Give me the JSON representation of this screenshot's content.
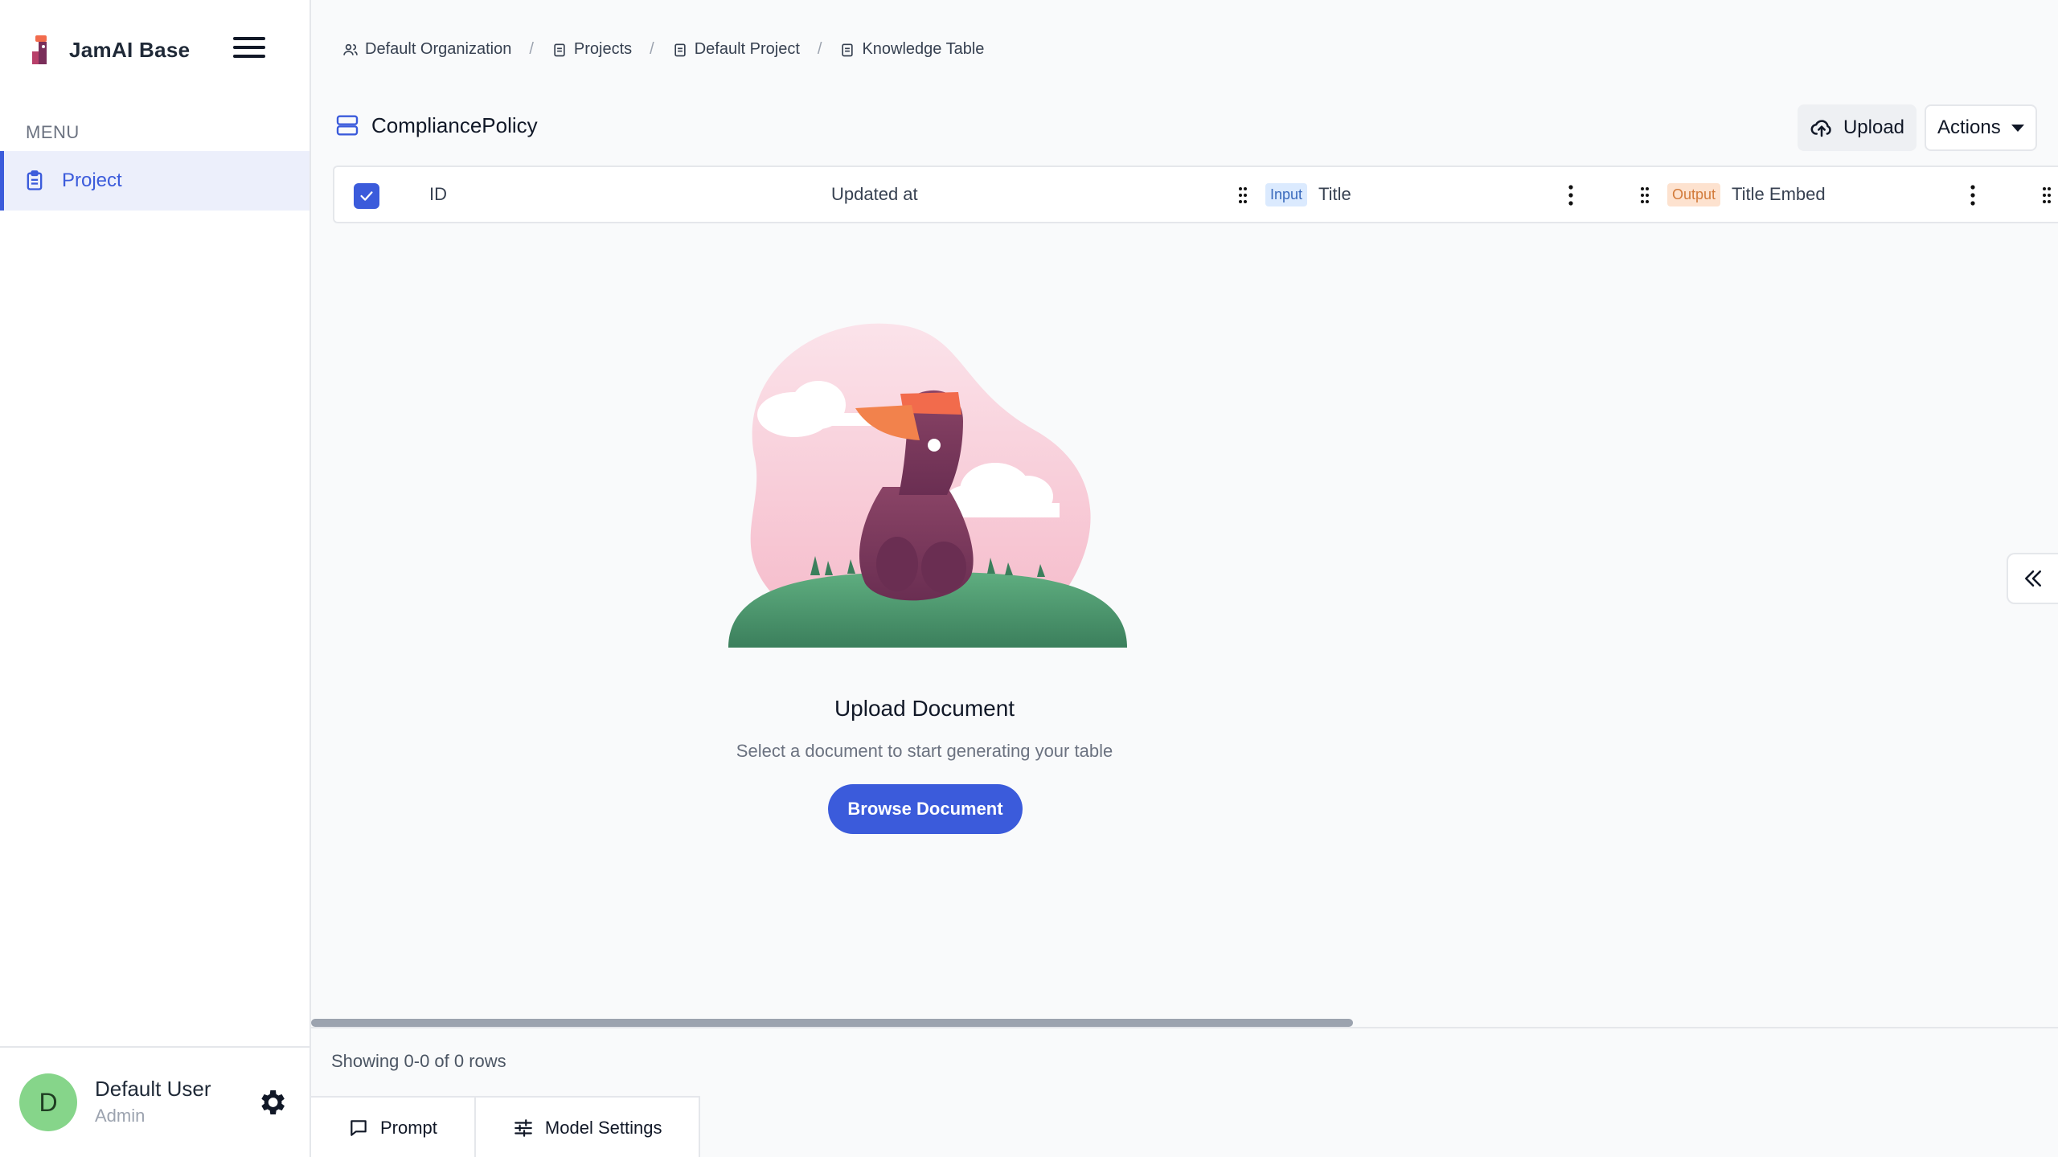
{
  "app": {
    "name": "JamAI Base"
  },
  "sidebar": {
    "menu_label": "MENU",
    "items": [
      {
        "label": "Project",
        "icon": "clipboard-icon",
        "active": true
      }
    ]
  },
  "user": {
    "initial": "D",
    "name": "Default User",
    "role": "Admin"
  },
  "breadcrumb": [
    {
      "label": "Default Organization",
      "icon": "users-icon"
    },
    {
      "label": "Projects",
      "icon": "clipboard-icon"
    },
    {
      "label": "Default Project",
      "icon": "clipboard-icon"
    },
    {
      "label": "Knowledge Table",
      "icon": "clipboard-icon"
    }
  ],
  "breadcrumb_sep": "/",
  "table": {
    "name": "CompliancePolicy",
    "upload_label": "Upload",
    "actions_label": "Actions",
    "columns": [
      {
        "label": "ID"
      },
      {
        "label": "Updated at"
      },
      {
        "label": "Title",
        "tag": "Input"
      },
      {
        "label": "Title Embed",
        "tag": "Output"
      }
    ]
  },
  "empty_state": {
    "title": "Upload Document",
    "subtitle": "Select a document to start generating your table",
    "button": "Browse Document"
  },
  "footer": {
    "row_count": "Showing 0-0 of 0 rows",
    "tabs": [
      {
        "label": "Prompt",
        "icon": "chat-icon"
      },
      {
        "label": "Model Settings",
        "icon": "sliders-icon"
      }
    ]
  },
  "colors": {
    "accent": "#3b5bdb",
    "input_tag": "#dbeafe",
    "output_tag": "#fde2cf"
  }
}
